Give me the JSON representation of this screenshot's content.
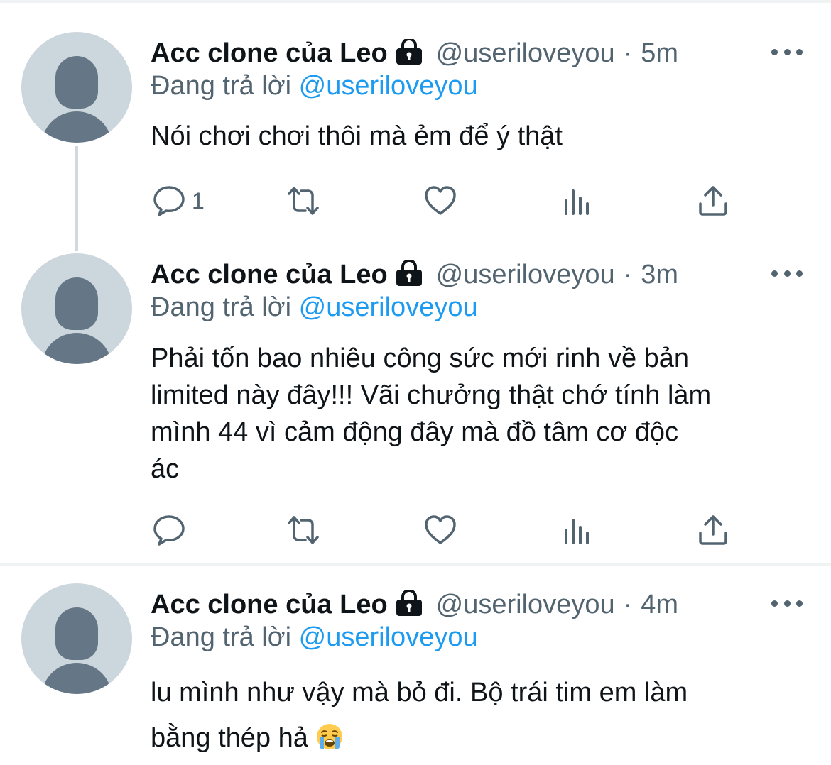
{
  "tweets": [
    {
      "display_name": "Acc clone của Leo",
      "handle": "@useriloveyou",
      "separator": "·",
      "time": "5m",
      "replying_label": "Đang trả lời",
      "replying_to": "@useriloveyou",
      "text_lines": [
        "Nói chơi chơi thôi mà ẻm để ý thật"
      ],
      "reply_count": "1"
    },
    {
      "display_name": "Acc clone của Leo",
      "handle": "@useriloveyou",
      "separator": "·",
      "time": "3m",
      "replying_label": "Đang trả lời",
      "replying_to": "@useriloveyou",
      "text_lines": [
        "Phải tốn bao nhiêu công sức mới rinh về bản",
        "limited này đây!!! Vãi chưởng thật chớ tính làm",
        "mình 44 vì cảm động đây mà đồ tâm cơ độc",
        "ác"
      ],
      "reply_count": ""
    },
    {
      "display_name": "Acc clone của Leo",
      "handle": "@useriloveyou",
      "separator": "·",
      "time": "4m",
      "replying_label": "Đang trả lời",
      "replying_to": "@useriloveyou",
      "text_lines": [
        "lu mình như vậy mà bỏ đi. Bộ trái tim em làm",
        "bằng thép hả"
      ],
      "emoji": "loudly-crying-face"
    }
  ],
  "icons": [
    "lock-icon",
    "more-icon",
    "reply-icon",
    "retweet-icon",
    "like-icon",
    "analytics-icon",
    "share-icon"
  ],
  "colors": {
    "text": "#0f1419",
    "secondary": "#536471",
    "accent": "#1d9bf0",
    "avatar_bg": "#ccd6dd",
    "avatar_fg": "#657786",
    "divider": "#eff3f4"
  }
}
